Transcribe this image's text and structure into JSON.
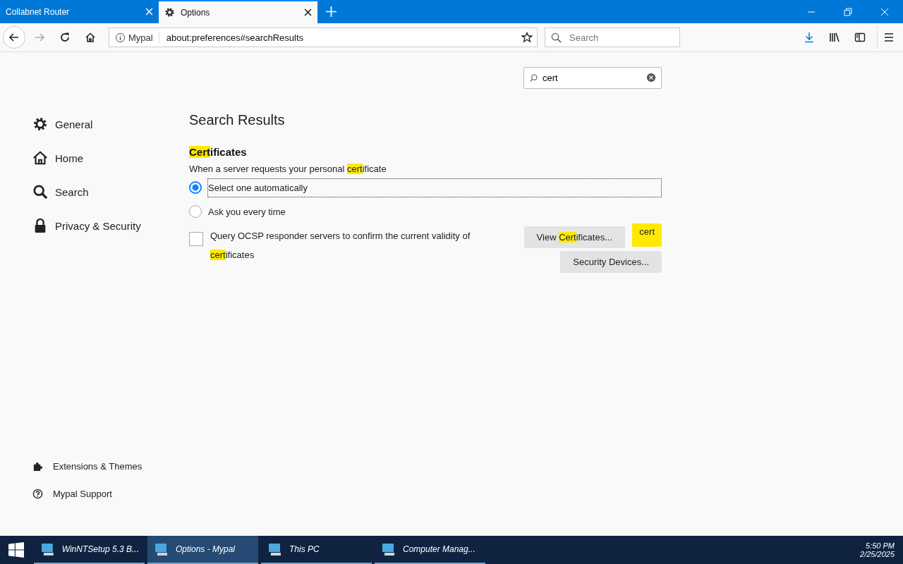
{
  "tabs": [
    {
      "title": "Collabnet Router",
      "selected": false,
      "kind": "plain"
    },
    {
      "title": "Options",
      "selected": true,
      "kind": "settings"
    }
  ],
  "address_bar": {
    "identity": "Mypal",
    "url": "about:preferences#searchResults"
  },
  "search_bar": {
    "placeholder": "Search"
  },
  "find_field": {
    "value": "cert"
  },
  "sidebar": {
    "items": [
      {
        "label": "General"
      },
      {
        "label": "Home"
      },
      {
        "label": "Search"
      },
      {
        "label": "Privacy & Security"
      }
    ],
    "footer": [
      {
        "label": "Extensions & Themes"
      },
      {
        "label": "Mypal Support"
      }
    ]
  },
  "page": {
    "title": "Search Results",
    "section": {
      "heading": [
        {
          "text": "Cert",
          "highlight": true
        },
        {
          "text": "ificates",
          "highlight": false
        }
      ],
      "prompt": [
        {
          "text": "When a server requests your personal ",
          "highlight": false
        },
        {
          "text": "cert",
          "highlight": true
        },
        {
          "text": "ificate",
          "highlight": false
        }
      ],
      "options": [
        {
          "label": "Select one automatically",
          "selected": true
        },
        {
          "label": "Ask you every time",
          "selected": false
        }
      ],
      "ocsp": {
        "checked": false,
        "label": [
          {
            "text": "Query OCSP responder servers to confirm the current validity of ",
            "highlight": false
          },
          {
            "text": "cert",
            "highlight": true
          },
          {
            "text": "ificates",
            "highlight": false
          }
        ]
      },
      "buttons": [
        [
          {
            "text": "View ",
            "highlight": false
          },
          {
            "text": "Cert",
            "highlight": true
          },
          {
            "text": "ificates...",
            "highlight": false
          }
        ],
        [
          {
            "text": "Security Devices...",
            "highlight": false
          }
        ]
      ],
      "tooltip": "cert"
    }
  },
  "taskbar": {
    "items": [
      {
        "label": "WinNTSetup 5.3 B...",
        "selected": false
      },
      {
        "label": "Options - Mypal",
        "selected": true
      },
      {
        "label": "This PC",
        "selected": false
      },
      {
        "label": "Computer Manag...",
        "selected": false
      }
    ],
    "time": "5:50 PM",
    "date": "2/25/2025"
  }
}
